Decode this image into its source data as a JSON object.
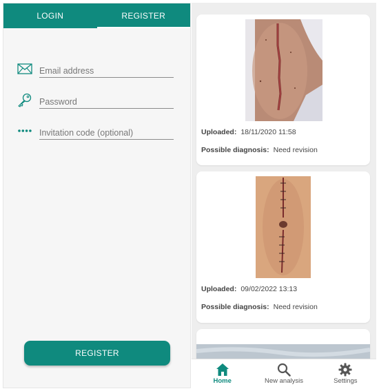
{
  "auth": {
    "tabs": [
      {
        "label": "LOGIN"
      },
      {
        "label": "REGISTER"
      }
    ],
    "email_placeholder": "Email address",
    "password_placeholder": "Password",
    "invitation_placeholder": "Invitation code (optional)",
    "register_button": "REGISTER"
  },
  "feed": {
    "uploaded_label": "Uploaded:",
    "diagnosis_label": "Possible diagnosis:",
    "cards": [
      {
        "uploaded": "18/11/2020 11:58",
        "diagnosis": "Need revision"
      },
      {
        "uploaded": "09/02/2022 13:13",
        "diagnosis": "Need revision"
      }
    ]
  },
  "nav": {
    "items": [
      {
        "label": "Home",
        "icon": "home-icon"
      },
      {
        "label": "New analysis",
        "icon": "search-icon"
      },
      {
        "label": "Settings",
        "icon": "gear-icon"
      }
    ]
  },
  "colors": {
    "accent": "#0f8a7e"
  }
}
